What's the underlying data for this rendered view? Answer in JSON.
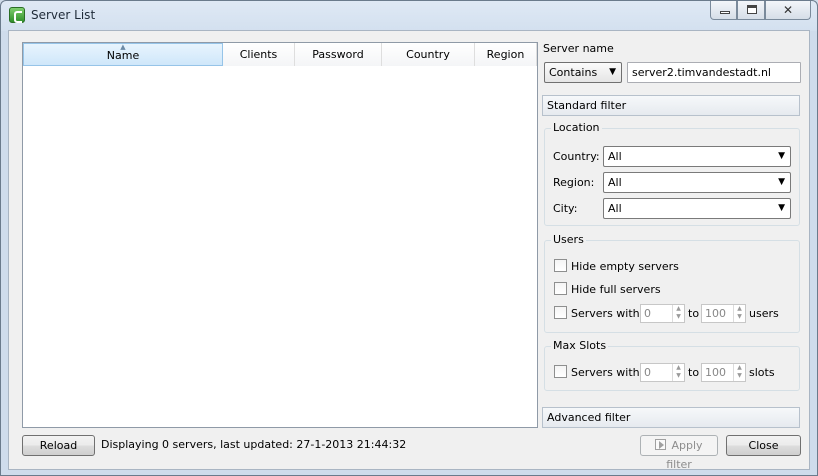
{
  "window": {
    "title": "Server List"
  },
  "table": {
    "columns": [
      {
        "label": "Name"
      },
      {
        "label": "Clients"
      },
      {
        "label": "Password"
      },
      {
        "label": "Country"
      },
      {
        "label": "Region"
      }
    ],
    "rows": []
  },
  "server_name": {
    "label": "Server name",
    "match_mode": "Contains",
    "value": "server2.timvandestadt.nl"
  },
  "standard_filter": {
    "label": "Standard filter"
  },
  "location": {
    "title": "Location",
    "country_label": "Country:",
    "country_value": "All",
    "region_label": "Region:",
    "region_value": "All",
    "city_label": "City:",
    "city_value": "All"
  },
  "users": {
    "title": "Users",
    "hide_empty_label": "Hide empty servers",
    "hide_full_label": "Hide full servers",
    "servers_with_label": "Servers with",
    "min_value": "0",
    "to_label": "to",
    "max_value": "100",
    "suffix": "users"
  },
  "max_slots": {
    "title": "Max Slots",
    "servers_with_label": "Servers with",
    "min_value": "0",
    "to_label": "to",
    "max_value": "100",
    "suffix": "slots"
  },
  "advanced_filter": {
    "label": "Advanced filter"
  },
  "footer": {
    "reload_label": "Reload",
    "status_text": "Displaying 0 servers, last updated: 27-1-2013 21:44:32",
    "apply_label": "Apply filter",
    "close_label": "Close"
  },
  "icons": [
    "app-icon",
    "minimize-icon",
    "maximize-icon",
    "close-icon",
    "sort-ascending-icon",
    "dropdown-arrow-icon",
    "spin-up-icon",
    "spin-down-icon",
    "apply-filter-icon"
  ]
}
